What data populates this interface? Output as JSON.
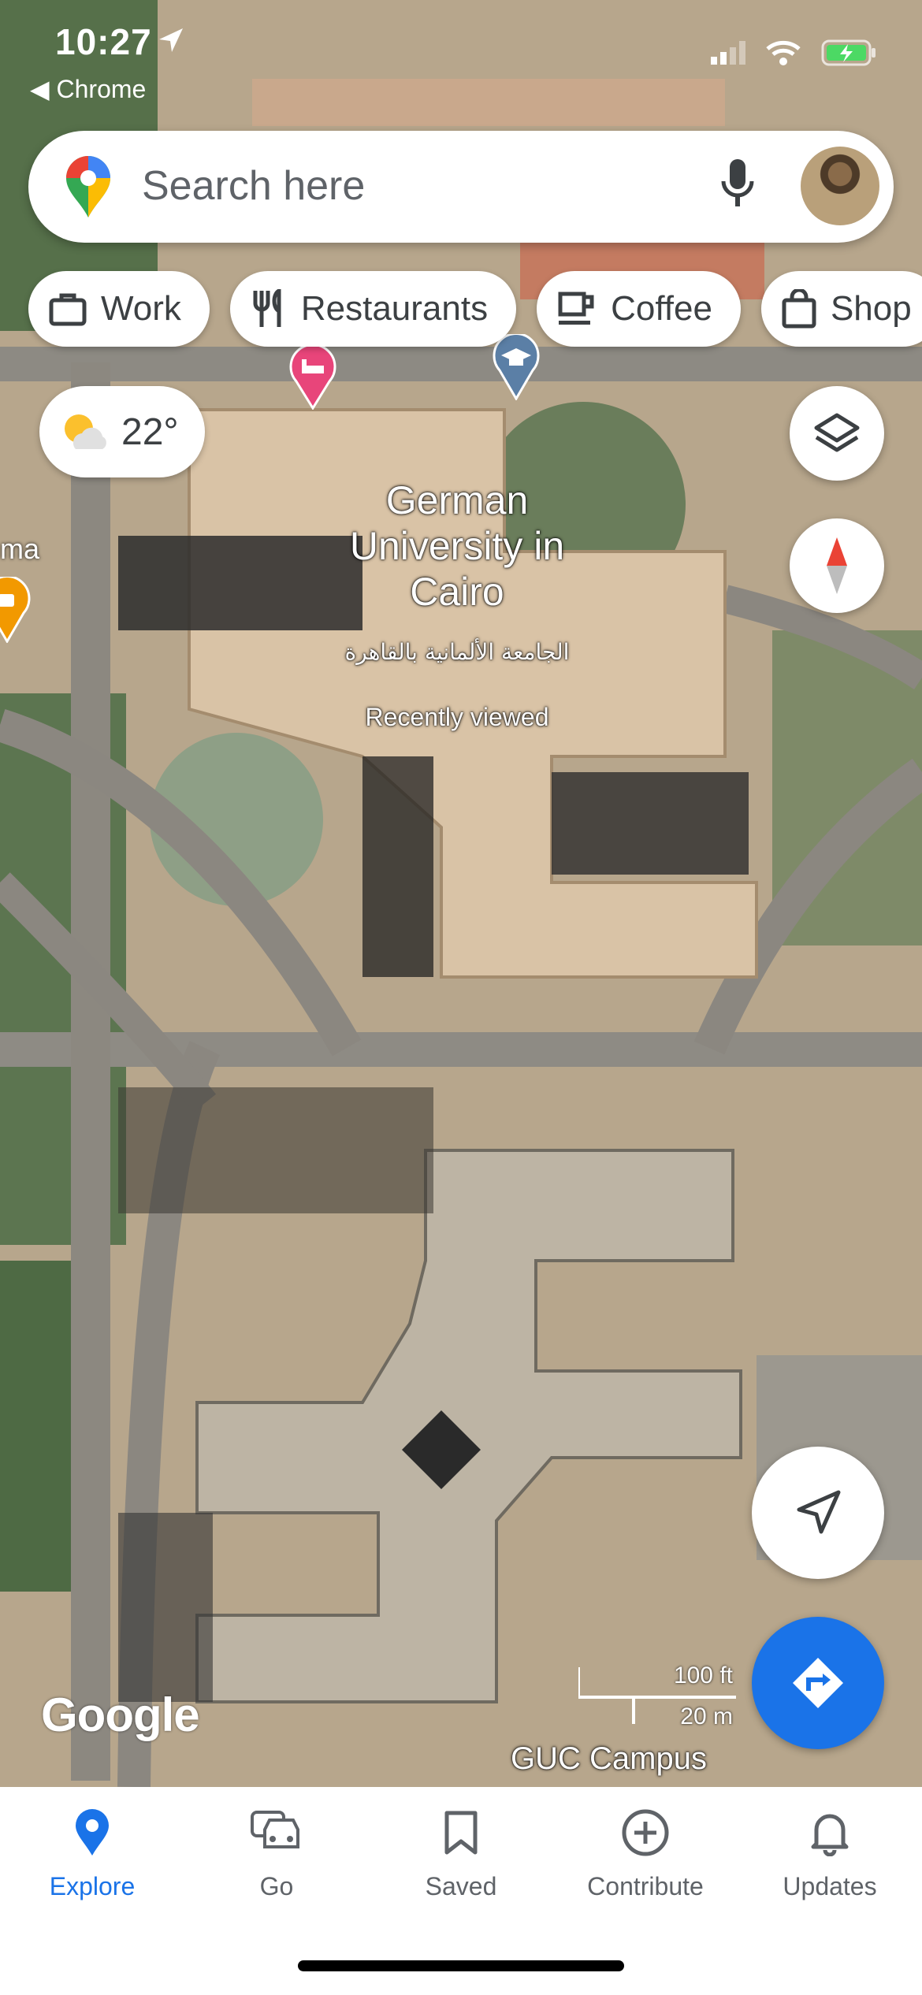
{
  "status_bar": {
    "time": "10:27",
    "back_app": "Chrome"
  },
  "search": {
    "placeholder": "Search here",
    "icons": [
      "google-maps-pin-icon",
      "microphone-icon",
      "avatar"
    ]
  },
  "chips": [
    {
      "label": "Work",
      "icon": "briefcase-icon"
    },
    {
      "label": "Restaurants",
      "icon": "fork-knife-icon"
    },
    {
      "label": "Coffee",
      "icon": "coffee-cup-icon"
    },
    {
      "label": "Shop",
      "icon": "shopping-bag-icon"
    }
  ],
  "weather": {
    "temperature": "22°",
    "icon": "partly-cloudy-icon"
  },
  "map": {
    "place_title": "German University in Cairo",
    "place_title_ar": "الجامعة الألمانية بالقاهرة",
    "place_subtitle": "Recently viewed",
    "side_label": "ma",
    "campus_label": "GUC Campus",
    "attribution": "Google",
    "scale_imperial": "100 ft",
    "scale_metric": "20 m",
    "markers": [
      "hotel-marker-icon",
      "school-marker-icon",
      "coffee-marker-icon"
    ]
  },
  "controls": [
    "layers-icon",
    "compass-icon",
    "my-location-icon",
    "directions-icon"
  ],
  "colors": {
    "accent": "#1a73e8",
    "hotel_marker": "#e8457a",
    "school_marker": "#5b7fa6",
    "coffee_marker": "#f29900"
  },
  "bottom_nav": [
    {
      "label": "Explore",
      "icon": "explore-pin-icon",
      "active": true
    },
    {
      "label": "Go",
      "icon": "car-icon",
      "active": false
    },
    {
      "label": "Saved",
      "icon": "bookmark-icon",
      "active": false
    },
    {
      "label": "Contribute",
      "icon": "plus-circle-icon",
      "active": false
    },
    {
      "label": "Updates",
      "icon": "bell-icon",
      "active": false
    }
  ]
}
